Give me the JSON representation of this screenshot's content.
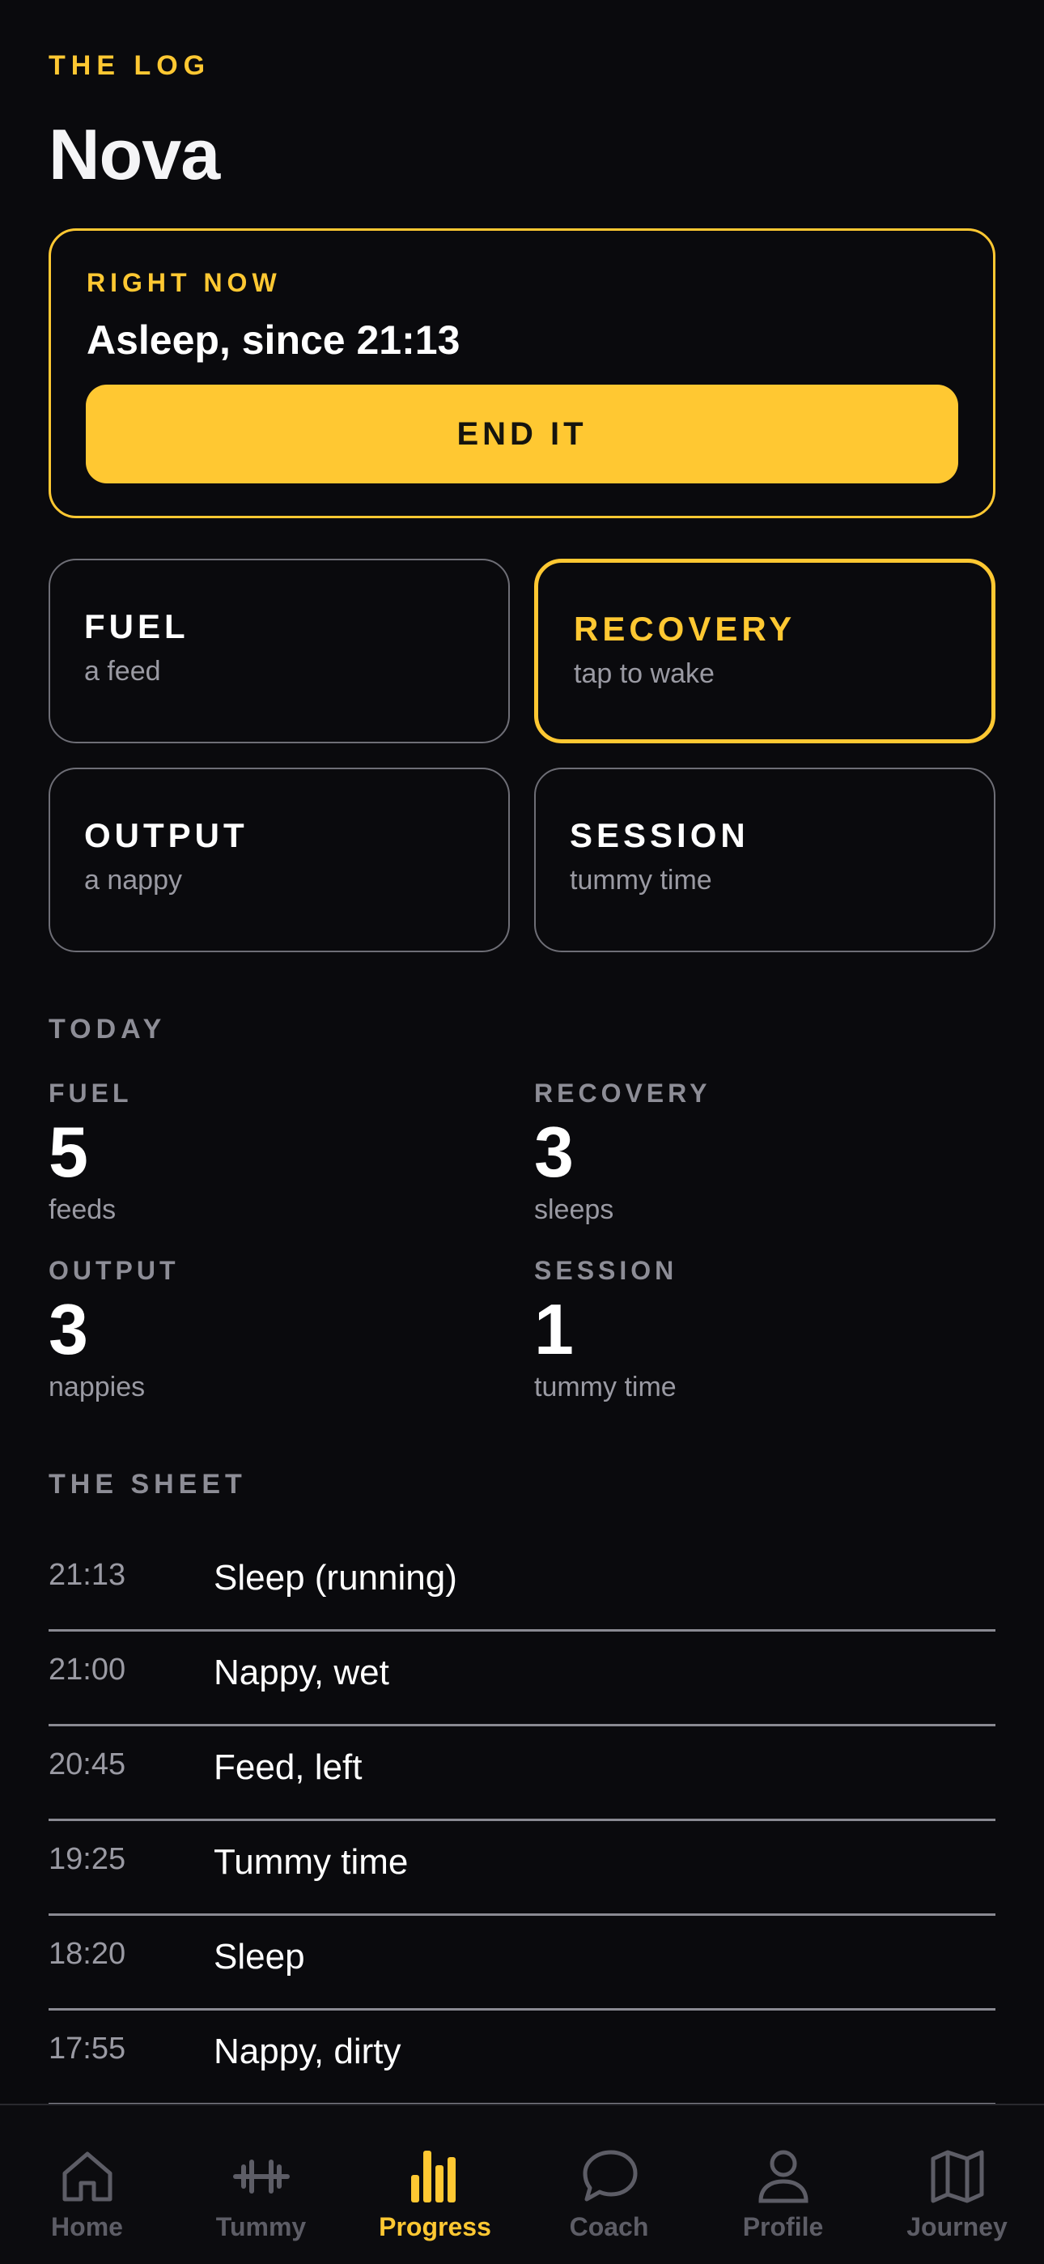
{
  "header": {
    "eyebrow": "THE LOG",
    "title": "Nova"
  },
  "right_now": {
    "label": "RIGHT NOW",
    "status": "Asleep, since 21:13",
    "button_label": "END IT"
  },
  "tiles": [
    {
      "name": "FUEL",
      "sub": "a feed",
      "active": false
    },
    {
      "name": "RECOVERY",
      "sub": "tap to wake",
      "active": true
    },
    {
      "name": "OUTPUT",
      "sub": "a nappy",
      "active": false
    },
    {
      "name": "SESSION",
      "sub": "tummy time",
      "active": false
    }
  ],
  "today": {
    "label": "TODAY",
    "stats": [
      {
        "label": "FUEL",
        "value": "5",
        "unit": "feeds"
      },
      {
        "label": "RECOVERY",
        "value": "3",
        "unit": "sleeps"
      },
      {
        "label": "OUTPUT",
        "value": "3",
        "unit": "nappies"
      },
      {
        "label": "SESSION",
        "value": "1",
        "unit": "tummy time"
      }
    ]
  },
  "sheet": {
    "label": "THE SHEET",
    "rows": [
      {
        "time": "21:13",
        "event": "Sleep (running)"
      },
      {
        "time": "21:00",
        "event": "Nappy, wet"
      },
      {
        "time": "20:45",
        "event": "Feed, left"
      },
      {
        "time": "19:25",
        "event": "Tummy time"
      },
      {
        "time": "18:20",
        "event": "Sleep"
      },
      {
        "time": "17:55",
        "event": "Nappy, dirty"
      }
    ]
  },
  "tabbar": {
    "tabs": [
      {
        "label": "Home",
        "icon": "house-icon",
        "active": false
      },
      {
        "label": "Tummy",
        "icon": "dumbbell-icon",
        "active": false
      },
      {
        "label": "Progress",
        "icon": "bar-chart-icon",
        "active": true
      },
      {
        "label": "Coach",
        "icon": "chat-bubble-icon",
        "active": false
      },
      {
        "label": "Profile",
        "icon": "person-icon",
        "active": false
      },
      {
        "label": "Journey",
        "icon": "map-icon",
        "active": false
      }
    ]
  },
  "colors": {
    "background": "#0a0a0d",
    "accent": "#ffc832",
    "muted": "#8d8d96",
    "inactive_tab": "#5d5d66"
  }
}
